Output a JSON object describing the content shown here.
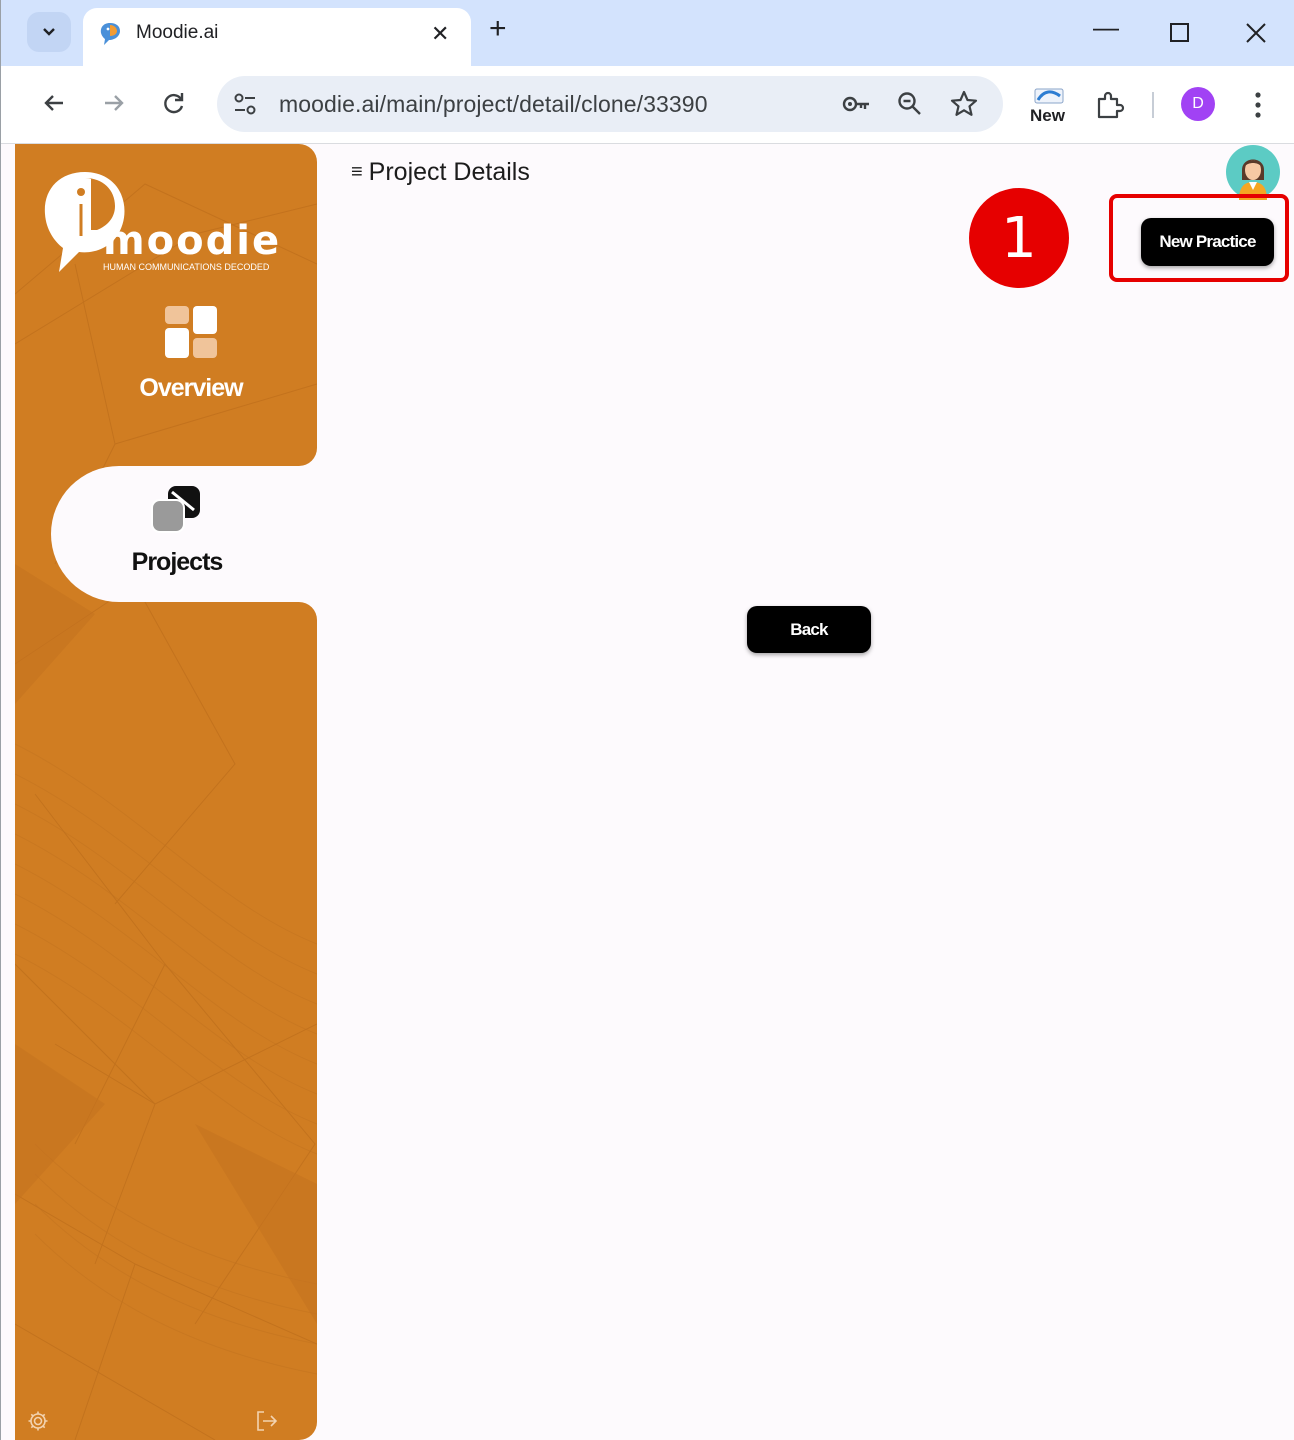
{
  "browser": {
    "tab_title": "Moodie.ai",
    "url": "moodie.ai/main/project/detail/clone/33390",
    "extension_new_label": "New",
    "profile_initial": "D",
    "icons": [
      "tab-search-chevron-icon",
      "favicon-icon",
      "close-tab-icon",
      "new-tab-icon",
      "minimize-icon",
      "maximize-icon",
      "close-window-icon",
      "back-icon",
      "forward-icon",
      "reload-icon",
      "site-settings-icon",
      "password-key-icon",
      "zoom-icon",
      "bookmark-star-icon",
      "extensions-puzzle-icon",
      "kebab-menu-icon"
    ]
  },
  "sidebar": {
    "logo_text": "MOODIE",
    "logo_tagline": "HUMAN COMMUNICATIONS DECODED",
    "items": [
      {
        "label": "Overview",
        "icon": "dashboard-grid-icon",
        "active": false
      },
      {
        "label": "Projects",
        "icon": "projects-stack-icon",
        "active": true
      }
    ],
    "bottom_icons": [
      "settings-gear-icon",
      "logout-icon"
    ],
    "color": "#d07d22"
  },
  "main": {
    "page_title": "Project Details",
    "new_practice_label": "New Practice",
    "back_label": "Back"
  },
  "annotation": {
    "step_number": "1",
    "color": "#e60000"
  }
}
